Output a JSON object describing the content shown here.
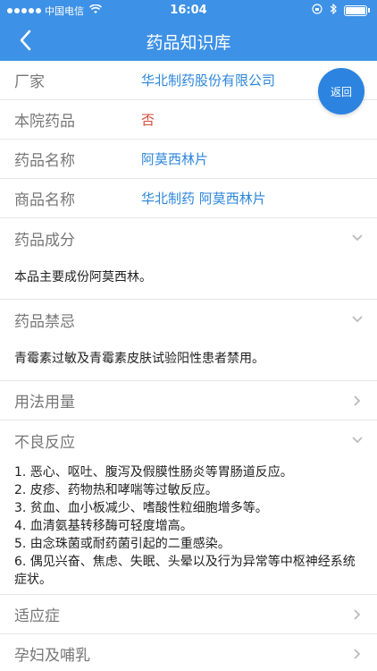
{
  "status": {
    "carrier": "中国电信",
    "time": "16:04"
  },
  "nav": {
    "title": "药品知识库"
  },
  "info_rows": [
    {
      "label": "厂家",
      "value": "华北制药股份有限公司"
    },
    {
      "label": "本院药品",
      "value": "否"
    },
    {
      "label": "药品名称",
      "value": "阿莫西林片"
    },
    {
      "label": "商品名称",
      "value": "华北制药 阿莫西林片"
    }
  ],
  "sections": {
    "ingredients": {
      "label": "药品成分",
      "text": "本品主要成份阿莫西林。"
    },
    "contraindications": {
      "label": "药品禁忌",
      "text": "青霉素过敏及青霉素皮肤试验阳性患者禁用。"
    },
    "dosage": {
      "label": "用法用量"
    },
    "adverse": {
      "label": "不良反应",
      "lines": [
        "1. 恶心、呕吐、腹泻及假膜性肠炎等胃肠道反应。",
        "2. 皮疹、药物热和哮喘等过敏反应。",
        "3. 贫血、血小板减少、嗜酸性粒细胞增多等。",
        "4. 血清氨基转移酶可轻度增高。",
        "5. 由念珠菌或耐药菌引起的二重感染。",
        "6. 偶见兴奋、焦虑、失眠、头晕以及行为异常等中枢神经系统症状。"
      ]
    },
    "indications": {
      "label": "适应症"
    },
    "pregnancy": {
      "label": "孕妇及哺乳"
    }
  },
  "fab": {
    "label": "返回"
  },
  "colors": {
    "primary": "#3D91E6",
    "link": "#2D86DB",
    "warn": "#D84A3B"
  }
}
